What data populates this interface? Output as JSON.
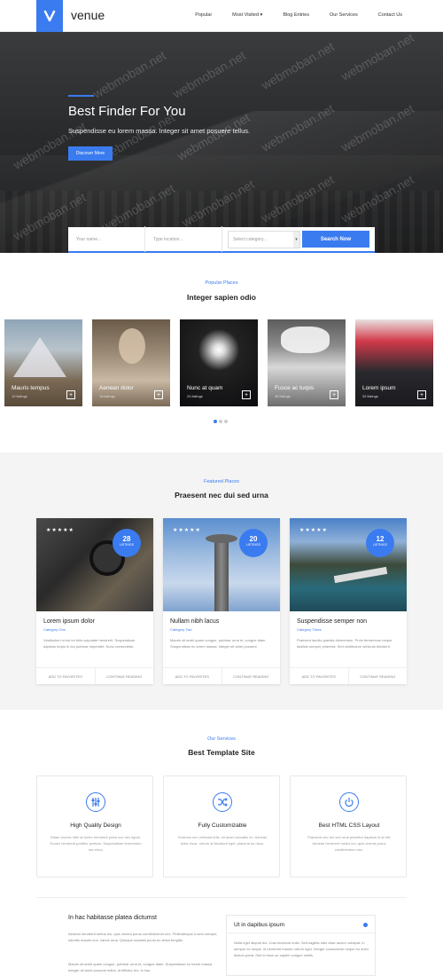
{
  "header": {
    "brand": "venue",
    "nav": [
      "Popular",
      "Most Visited ▾",
      "Blog Entries",
      "Our Services",
      "Contact Us"
    ]
  },
  "hero": {
    "title": "Best Finder For You",
    "subtitle": "Suspendisse eu lorem massa. Integer sit amet posuere tellus.",
    "button": "Discover More",
    "watermark": "webmoban.net"
  },
  "search": {
    "name_placeholder": "Your name...",
    "location_placeholder": "Type location...",
    "category_placeholder": "Select category...",
    "button": "Search Now"
  },
  "popular": {
    "eyebrow": "Popular Places",
    "title": "Integer sapien odio",
    "places": [
      {
        "name": "Mauris tempus",
        "count": "10 listings"
      },
      {
        "name": "Aenean dolor",
        "count": "18 listings"
      },
      {
        "name": "Nunc at quam",
        "count": "24 listings"
      },
      {
        "name": "Fusce ac turpis",
        "count": "36 listings"
      },
      {
        "name": "Lorem ipsum",
        "count": "32 listings"
      }
    ]
  },
  "featured": {
    "eyebrow": "Featured Places",
    "title": "Praesent nec dui sed urna",
    "cards": [
      {
        "stars": "★★★★★",
        "num": "28",
        "num_label": "LISTINGS",
        "title": "Lorem ipsum dolor",
        "category": "Category One",
        "desc": "Vestibulum id est eu felis vulputate hendrerit. Suspendisse dapibus turpis in dui pulvinar imperdiet. Nunc consectetur.",
        "fav": "ADD TO FAVORITES",
        "more": "CONTINUE READING"
      },
      {
        "stars": "★★★★★",
        "num": "20",
        "num_label": "LISTINGS",
        "title": "Nullam nibh lacus",
        "category": "Category Two",
        "desc": "Mauris sit amet quam congue, pulvinar urna et, congue diam. Suspendisse eu lorem massa. Integer sit amet posuere.",
        "fav": "ADD TO FAVORITES",
        "more": "CONTINUE READING"
      },
      {
        "stars": "★★★★★",
        "num": "12",
        "num_label": "LISTINGS",
        "title": "Suspendisse semper non",
        "category": "Category Three",
        "desc": "Praesent iaculis gravida elementum. Proin fermentum neque facilisis semper pharetra. Sed vestibulum vehicula tincidunt.",
        "fav": "ADD TO FAVORITES",
        "more": "CONTINUE READING"
      }
    ]
  },
  "services": {
    "eyebrow": "Our Services",
    "title": "Best Template Site",
    "items": [
      {
        "icon": "sliders-icon",
        "title": "High Quality Design",
        "desc": "Etiam viverra nibh at lorem hendrerit porta non nec ligula. Donec hendrerit porttitor pretium. Suspendisse fermentum nec risus."
      },
      {
        "icon": "shuffle-icon",
        "title": "Fully Customizable",
        "desc": "Vivamus nec vehicula felis, sit amet convallis ex. Aenean dolor risus, rutrum at tincidunt eget, placerat ac risus."
      },
      {
        "icon": "power-icon",
        "title": "Best HTML CSS Layout",
        "desc": "Praesent nec dui sed urna pharetra dapibus id at elit. Aenean hendrerit metus leo, quis viverra purus condimentum nec."
      }
    ]
  },
  "blog": {
    "title": "In hac habitasse platea dictumst",
    "p1": "Aenean hendrerit metus leo, quis viverra purus condimentum nec. Pellentesque a sem semper, lobortis mauris non, varius urna. Quisque sodales purus eu tellus fringilla.",
    "p2": "Mauris sit amet quam congue, pulvinar urna et, congue diam. Suspendisse eu lorem massa. Integer sit amet posuere tellus, id efficitur leo. In hac"
  },
  "accordion": {
    "title": "Ut in dapibus ipsum",
    "body": "Nulla eget aliquet dui. Cras tincidunt nulla. Sed sagittis odio vitae auctor volutpat. In semper ex neque, id hendrerit mauris rutrum eget. Integer consectetur neque eu enim dictum porta. Sed id risus ac sapien congue mollis."
  },
  "colors": {
    "accent": "#3a7bf0"
  }
}
